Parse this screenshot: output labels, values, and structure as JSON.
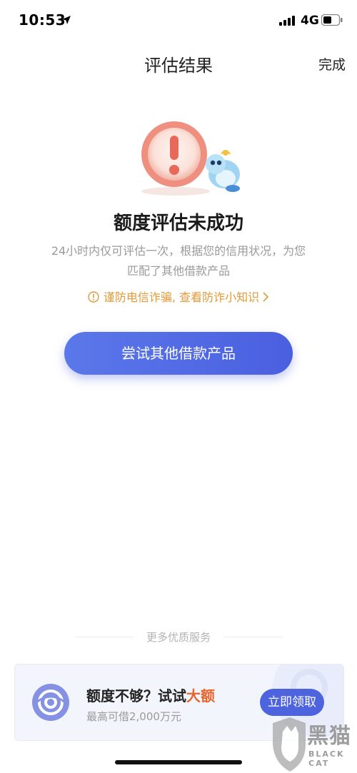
{
  "status_bar": {
    "time": "10:53",
    "network": "4G"
  },
  "nav": {
    "title": "评估结果",
    "done_label": "完成"
  },
  "result": {
    "title": "额度评估未成功",
    "description": "24小时内仅可评估一次，根据您的信用状况，为您匹配了其他借款产品",
    "fraud_link": "谨防电信诈骗, 查看防诈小知识"
  },
  "primary_button": {
    "label": "尝试其他借款产品",
    "color": "#5068e4"
  },
  "more_services": {
    "label": "更多优质服务"
  },
  "promo": {
    "title_prefix": "额度不够？试试",
    "title_highlight": "大额",
    "subtitle": "最高可借2,000万元",
    "button_label": "立即领取",
    "accent": "#e8642b"
  },
  "watermark": {
    "text": "黑猫",
    "sub": "BLACK CAT"
  },
  "colors": {
    "warning": "#e39a35",
    "brand": "#4e63de"
  }
}
